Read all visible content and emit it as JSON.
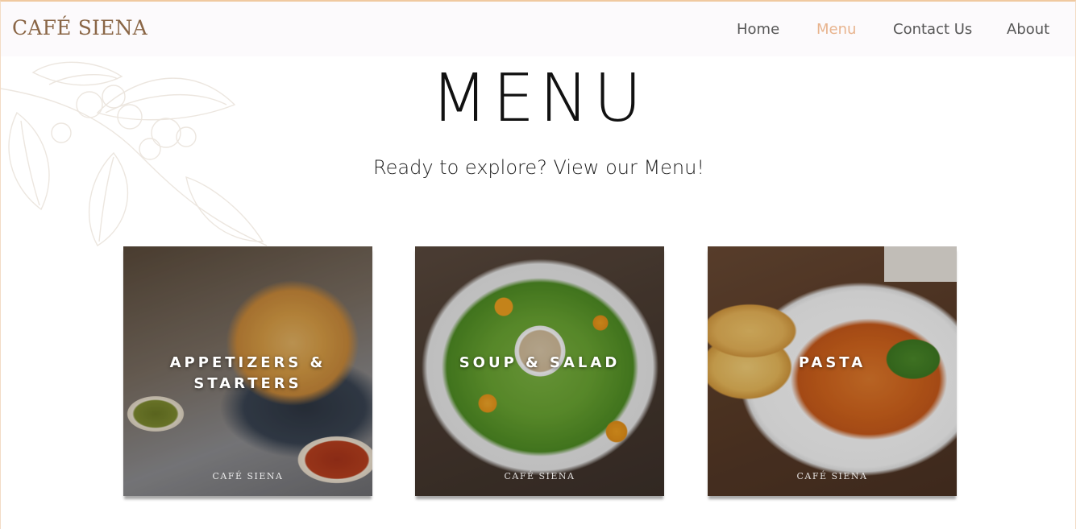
{
  "brand": "CAFÉ SIENA",
  "nav": [
    {
      "label": "Home",
      "active": false
    },
    {
      "label": "Menu",
      "active": true
    },
    {
      "label": "Contact Us",
      "active": false
    },
    {
      "label": "About",
      "active": false
    }
  ],
  "hero": {
    "title": "MENU",
    "subtitle": "Ready to explore? View our Menu!"
  },
  "cards": [
    {
      "title_line1": "APPETIZERS &",
      "title_line2": "STARTERS",
      "watermark": "CAFÉ SIENA"
    },
    {
      "title_line1": "SOUP & SALAD",
      "title_line2": "",
      "watermark": "CAFÉ SIENA"
    },
    {
      "title_line1": "PASTA",
      "title_line2": "",
      "watermark": "CAFÉ SIENA"
    }
  ],
  "colors": {
    "brand": "#8a6646",
    "nav_active": "#e8b48e",
    "nav_default": "#565656",
    "header_bg": "#fcfafc"
  },
  "icons": [
    "leaf-branch-illustration"
  ]
}
